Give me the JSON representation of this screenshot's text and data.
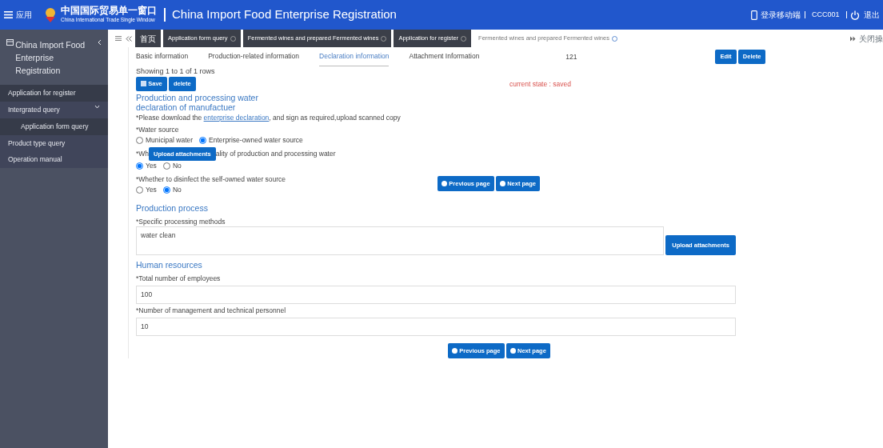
{
  "header": {
    "menu_label": "应用",
    "logo_cn": "中国国际贸易单一窗口",
    "logo_en": "China International Trade Single Window",
    "title": "China Import Food Enterprise Registration",
    "mobile": "登录移动端",
    "user": "CCC001",
    "logout": "退出"
  },
  "sidebar": {
    "title": "China Import Food Enterprise Registration",
    "items": [
      {
        "label": "Application for register",
        "selected": true
      },
      {
        "label": "Intergrated query",
        "selected": false,
        "expanded": true,
        "children": [
          {
            "label": "Application form query",
            "selected": false
          }
        ]
      },
      {
        "label": "Product type query",
        "selected": false
      },
      {
        "label": "Operation manual",
        "selected": false
      }
    ]
  },
  "page_tabs": {
    "items": [
      {
        "label": "首页",
        "selected": false,
        "closable": false
      },
      {
        "label": "Application form query",
        "selected": false,
        "closable": true
      },
      {
        "label": "Fermented wines and prepared Fermented wines",
        "selected": false,
        "closable": true
      },
      {
        "label": "Application for register",
        "selected": false,
        "closable": true
      },
      {
        "label": "Fermented wines and prepared Fermented wines",
        "selected": true,
        "closable": true
      }
    ],
    "close_ops": "关闭操"
  },
  "sub_tabs": [
    {
      "label": "Basic information",
      "selected": false
    },
    {
      "label": "Production-related information",
      "selected": false
    },
    {
      "label": "Declaration information",
      "selected": true
    },
    {
      "label": "Attachment Information",
      "selected": false
    }
  ],
  "table": {
    "registration_number": "121",
    "buttons": [
      "Edit",
      "Delete"
    ],
    "pagination": "Showing 1 to 1 of 1 rows"
  },
  "toolbar": {
    "buttons": [
      "Save",
      "delete"
    ],
    "status": "current state : saved"
  },
  "declaration": {
    "heading": "Production and processing water declaration of manufactuer",
    "note_before": "*Please download the",
    "note_link": "enterprise declaration",
    "note_after": ", and sign as required,upload scanned copy",
    "water_source": {
      "label": "*Water source",
      "options": [
        {
          "label": "Municipal water",
          "selected": false
        },
        {
          "label": "Enterprise-owned water source",
          "selected": true
        }
      ]
    },
    "quality": {
      "label_start": "*Wh",
      "upload": "Upload attachments",
      "label_end": "ality of production and processing water",
      "options": [
        {
          "label": "Yes",
          "selected": true
        },
        {
          "label": "No",
          "selected": false
        }
      ]
    },
    "disinfect": {
      "label": "*Whether to disinfect the self-owned water source",
      "options": [
        {
          "label": "Yes",
          "selected": false
        },
        {
          "label": "No",
          "selected": true
        }
      ]
    },
    "nav": [
      "Previous page",
      "Next page"
    ]
  },
  "production": {
    "heading": "Production process",
    "label": "*Specific processing methods",
    "value": "water clean",
    "upload": "Upload attachments"
  },
  "human": {
    "heading": "Human resources",
    "fields": [
      {
        "label": "*Total number of employees",
        "value": "100"
      },
      {
        "label": "*Number of management and technical personnel",
        "value": "10"
      }
    ]
  },
  "bottom_nav": [
    "Previous page",
    "Next page"
  ]
}
